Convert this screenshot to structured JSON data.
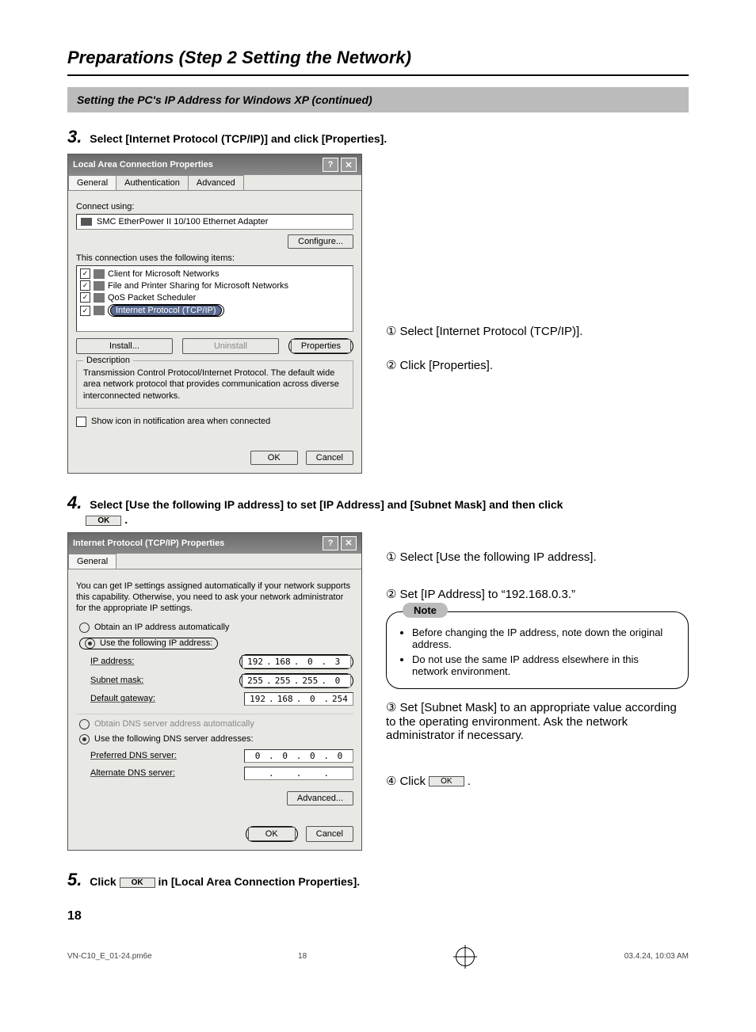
{
  "page_title": "Preparations (Step 2 Setting the Network)",
  "subheading": "Setting the PC's IP Address for Windows XP (continued)",
  "step3": {
    "num": "3.",
    "text": "Select [Internet Protocol (TCP/IP)] and click [Properties].",
    "dialog": {
      "title": "Local Area Connection Properties",
      "tabs": [
        "General",
        "Authentication",
        "Advanced"
      ],
      "connect_using_label": "Connect using:",
      "adapter": "SMC EtherPower II 10/100 Ethernet Adapter",
      "configure": "Configure...",
      "items_label": "This connection uses the following items:",
      "items": [
        "Client for Microsoft Networks",
        "File and Printer Sharing for Microsoft Networks",
        "QoS Packet Scheduler",
        "Internet Protocol (TCP/IP)"
      ],
      "buttons": {
        "install": "Install...",
        "uninstall": "Uninstall",
        "properties": "Properties"
      },
      "description_label": "Description",
      "description": "Transmission Control Protocol/Internet Protocol. The default wide area network protocol that provides communication across diverse interconnected networks.",
      "show_icon": "Show icon in notification area when connected",
      "ok": "OK",
      "cancel": "Cancel"
    },
    "annotations": [
      "Select [Internet Protocol (TCP/IP)].",
      "Click [Properties]."
    ]
  },
  "step4": {
    "num": "4.",
    "text_a": "Select [Use the following IP address] to set [IP Address] and [Subnet Mask] and then click",
    "ok_btn": "OK",
    "text_b": ".",
    "dialog": {
      "title": "Internet Protocol (TCP/IP) Properties",
      "tab": "General",
      "intro": "You can get IP settings assigned automatically if your network supports this capability. Otherwise, you need to ask your network administrator for the appropriate IP settings.",
      "radio_auto": "Obtain an IP address automatically",
      "radio_manual": "Use the following IP address:",
      "ip_label": "IP address:",
      "ip_value": [
        "192",
        "168",
        "0",
        "3"
      ],
      "subnet_label": "Subnet mask:",
      "subnet_value": [
        "255",
        "255",
        "255",
        "0"
      ],
      "gateway_label": "Default gateway:",
      "gateway_value": [
        "192",
        "168",
        "0",
        "254"
      ],
      "dns_auto": "Obtain DNS server address automatically",
      "dns_manual": "Use the following DNS server addresses:",
      "pref_dns_label": "Preferred DNS server:",
      "pref_dns_value": [
        "0",
        "0",
        "0",
        "0"
      ],
      "alt_dns_label": "Alternate DNS server:",
      "alt_dns_value": [
        "",
        "",
        "",
        ""
      ],
      "advanced": "Advanced...",
      "ok": "OK",
      "cancel": "Cancel"
    },
    "annotations": {
      "a1": "Select [Use the following IP address].",
      "a2": "Set [IP Address] to “192.168.0.3.”",
      "note_label": "Note",
      "note_items": [
        "Before changing the IP address, note down the original address.",
        "Do not use the same IP address elsewhere in this network environment."
      ],
      "a3": "Set [Subnet Mask] to an appropriate value according to the operating environment. Ask the network administrator if necessary.",
      "a4_pre": "Click",
      "a4_btn": "OK",
      "a4_post": "."
    }
  },
  "step5": {
    "num": "5.",
    "text_a": "Click",
    "ok_btn": "OK",
    "text_b": "in [Local Area Connection Properties]."
  },
  "page_number": "18",
  "footer": {
    "file": "VN-C10_E_01-24.pm6e",
    "page": "18",
    "timestamp": "03.4.24, 10:03 AM"
  }
}
